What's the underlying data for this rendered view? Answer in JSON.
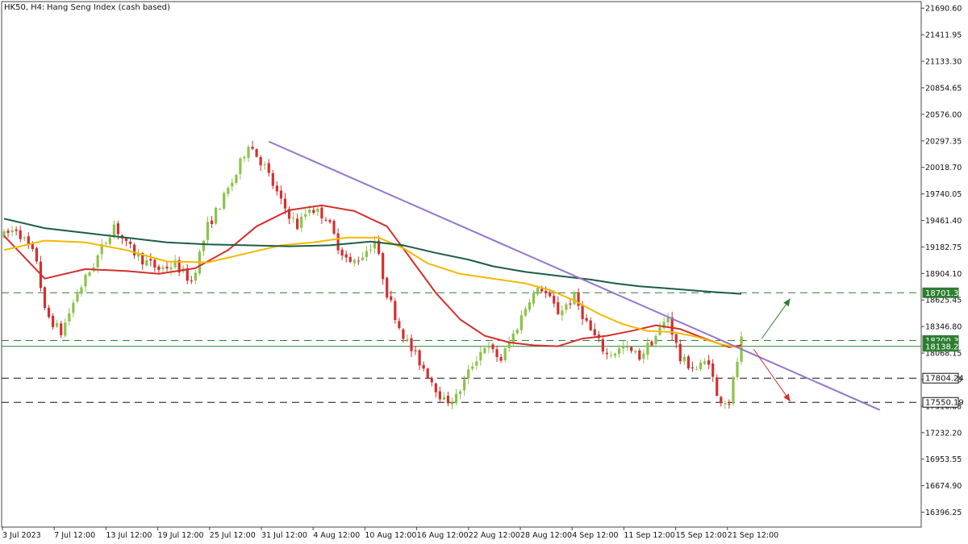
{
  "header": {
    "symbol": "HK50, H4:",
    "description": "Hang Seng Index (cash based)"
  },
  "colors": {
    "up_candle": "#8bc34a",
    "down_candle": "#d32f2f",
    "ma_fast": "#d32f2f",
    "ma_mid": "#f5b800",
    "ma_slow": "#1b5e45",
    "trendline": "#9575cd",
    "level_green": "#2e7d32",
    "level_dark": "#111111",
    "arrow_up": "#2e7d32",
    "arrow_down": "#d32f2f"
  },
  "chart_data": {
    "type": "candlestick",
    "title": "HK50, H4:  Hang Seng Index (cash based)",
    "ylim": [
      16240,
      21760
    ],
    "y_ticks": [
      "21690.60",
      "21411.95",
      "21133.30",
      "20854.65",
      "20576.00",
      "20297.35",
      "20018.70",
      "19740.05",
      "19461.40",
      "19182.75",
      "18904.10",
      "18625.45",
      "18346.80",
      "18068.15",
      "17789.50",
      "17510.85",
      "17232.20",
      "16953.55",
      "16674.90",
      "16396.25"
    ],
    "x_ticks": [
      "3 Jul 2023",
      "7 Jul 12:00",
      "13 Jul 12:00",
      "19 Jul 12:00",
      "25 Jul 12:00",
      "31 Jul 12:00",
      "4 Aug 12:00",
      "10 Aug 12:00",
      "16 Aug 12:00",
      "22 Aug 12:00",
      "28 Aug 12:00",
      "4 Sep 12:00",
      "11 Sep 12:00",
      "15 Sep 12:00",
      "21 Sep 12:00"
    ],
    "price_path": [
      [
        0,
        19300
      ],
      [
        3,
        19380
      ],
      [
        8,
        19050
      ],
      [
        10,
        18500
      ],
      [
        14,
        18280
      ],
      [
        18,
        18700
      ],
      [
        22,
        19000
      ],
      [
        27,
        19420
      ],
      [
        30,
        19200
      ],
      [
        34,
        19050
      ],
      [
        38,
        18950
      ],
      [
        42,
        19000
      ],
      [
        46,
        18820
      ],
      [
        50,
        19400
      ],
      [
        54,
        19700
      ],
      [
        57,
        19950
      ],
      [
        60,
        20280
      ],
      [
        64,
        20020
      ],
      [
        68,
        19650
      ],
      [
        72,
        19400
      ],
      [
        75,
        19600
      ],
      [
        79,
        19500
      ],
      [
        82,
        19200
      ],
      [
        85,
        19000
      ],
      [
        88,
        19100
      ],
      [
        91,
        19250
      ],
      [
        94,
        18700
      ],
      [
        97,
        18350
      ],
      [
        100,
        18100
      ],
      [
        104,
        17850
      ],
      [
        108,
        17560
      ],
      [
        111,
        17600
      ],
      [
        115,
        17950
      ],
      [
        118,
        18150
      ],
      [
        122,
        18000
      ],
      [
        126,
        18350
      ],
      [
        129,
        18650
      ],
      [
        132,
        18750
      ],
      [
        136,
        18500
      ],
      [
        140,
        18650
      ],
      [
        144,
        18300
      ],
      [
        148,
        18050
      ],
      [
        152,
        18120
      ],
      [
        156,
        18030
      ],
      [
        160,
        18250
      ],
      [
        163,
        18450
      ],
      [
        166,
        18000
      ],
      [
        170,
        17900
      ],
      [
        173,
        18000
      ],
      [
        175,
        17600
      ],
      [
        178,
        17560
      ],
      [
        181,
        18200
      ]
    ],
    "series": [
      {
        "name": "",
        "color": "#d32f2f",
        "points": [
          [
            0,
            19300
          ],
          [
            10,
            18850
          ],
          [
            20,
            18950
          ],
          [
            30,
            18930
          ],
          [
            38,
            18900
          ],
          [
            47,
            18960
          ],
          [
            55,
            19150
          ],
          [
            62,
            19400
          ],
          [
            70,
            19570
          ],
          [
            78,
            19620
          ],
          [
            86,
            19560
          ],
          [
            94,
            19400
          ],
          [
            100,
            19050
          ],
          [
            106,
            18700
          ],
          [
            112,
            18420
          ],
          [
            118,
            18250
          ],
          [
            124,
            18180
          ],
          [
            130,
            18150
          ],
          [
            136,
            18140
          ],
          [
            142,
            18220
          ],
          [
            148,
            18250
          ],
          [
            154,
            18300
          ],
          [
            160,
            18360
          ],
          [
            166,
            18320
          ],
          [
            172,
            18220
          ],
          [
            178,
            18130
          ],
          [
            181,
            18150
          ]
        ]
      },
      {
        "name": "",
        "color": "#f5b800",
        "points": [
          [
            0,
            19150
          ],
          [
            10,
            19250
          ],
          [
            20,
            19230
          ],
          [
            30,
            19150
          ],
          [
            40,
            19030
          ],
          [
            50,
            19020
          ],
          [
            60,
            19120
          ],
          [
            68,
            19200
          ],
          [
            76,
            19230
          ],
          [
            84,
            19280
          ],
          [
            92,
            19280
          ],
          [
            98,
            19170
          ],
          [
            104,
            19010
          ],
          [
            112,
            18900
          ],
          [
            120,
            18850
          ],
          [
            128,
            18800
          ],
          [
            134,
            18730
          ],
          [
            140,
            18620
          ],
          [
            146,
            18480
          ],
          [
            152,
            18370
          ],
          [
            158,
            18300
          ],
          [
            164,
            18290
          ],
          [
            170,
            18240
          ],
          [
            176,
            18160
          ],
          [
            181,
            18120
          ]
        ]
      },
      {
        "name": "",
        "color": "#1b5e45",
        "points": [
          [
            0,
            19480
          ],
          [
            10,
            19380
          ],
          [
            20,
            19330
          ],
          [
            30,
            19280
          ],
          [
            40,
            19230
          ],
          [
            50,
            19210
          ],
          [
            60,
            19200
          ],
          [
            70,
            19190
          ],
          [
            80,
            19200
          ],
          [
            90,
            19240
          ],
          [
            98,
            19200
          ],
          [
            106,
            19120
          ],
          [
            114,
            19050
          ],
          [
            120,
            18980
          ],
          [
            128,
            18920
          ],
          [
            136,
            18880
          ],
          [
            144,
            18840
          ],
          [
            150,
            18800
          ],
          [
            156,
            18770
          ],
          [
            162,
            18750
          ],
          [
            168,
            18730
          ],
          [
            174,
            18710
          ],
          [
            181,
            18690
          ]
        ]
      }
    ],
    "trendline": {
      "from": [
        65,
        20290
      ],
      "to": [
        215,
        17470
      ]
    },
    "levels": [
      {
        "value": "18701.33",
        "color": "#2e7d32",
        "style": "dashed"
      },
      {
        "value": "18200.34",
        "color": "#2e7d32",
        "style": "dashed"
      },
      {
        "value": "18138.20",
        "color": "#2e7d32",
        "style": "solid"
      },
      {
        "value": "17804.24",
        "color": "#111111",
        "style": "dashed"
      },
      {
        "value": "17550.19",
        "color": "#111111",
        "style": "dashed"
      }
    ],
    "arrows": [
      {
        "direction": "up",
        "from": [
          186,
          18220
        ],
        "to": [
          193,
          18640
        ],
        "color": "#2e7d32"
      },
      {
        "direction": "down",
        "from": [
          184,
          18110
        ],
        "to": [
          193,
          17560
        ],
        "color": "#d32f2f"
      }
    ]
  }
}
